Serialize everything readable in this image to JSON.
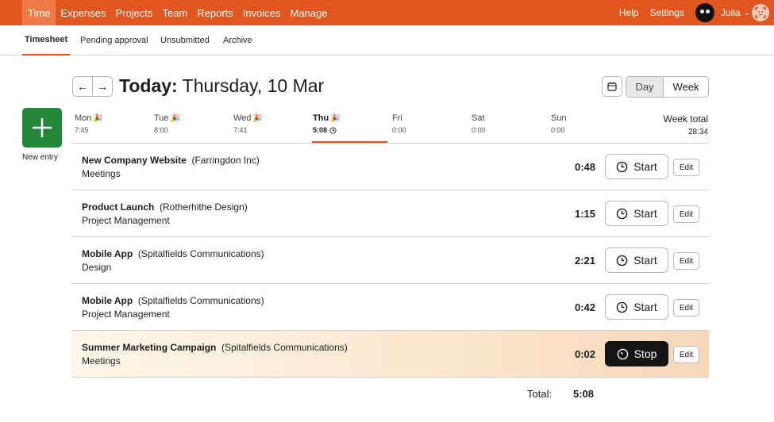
{
  "topnav": {
    "items": [
      "Time",
      "Expenses",
      "Projects",
      "Team",
      "Reports",
      "Invoices",
      "Manage"
    ],
    "help": "Help",
    "settings": "Settings",
    "user": "Julia",
    "brand_color": "#e1561f"
  },
  "subnav": {
    "tabs": [
      "Timesheet",
      "Pending approval",
      "Unsubmitted",
      "Archive"
    ],
    "active": "Timesheet"
  },
  "header": {
    "title_bold": "Today:",
    "title_rest": "Thursday, 10 Mar",
    "view_day": "Day",
    "view_week": "Week",
    "selected_view": "Day"
  },
  "new_entry": {
    "label": "New entry"
  },
  "days": [
    {
      "name": "Mon",
      "time": "7:45"
    },
    {
      "name": "Tue",
      "time": "8:00"
    },
    {
      "name": "Wed",
      "time": "7:41"
    },
    {
      "name": "Thu",
      "time": "5:08"
    },
    {
      "name": "Fri",
      "time": "0:00"
    },
    {
      "name": "Sat",
      "time": "0:00"
    },
    {
      "name": "Sun",
      "time": "0:00"
    }
  ],
  "week_total": {
    "label": "Week total",
    "value": "28:34"
  },
  "entries": [
    {
      "project": "New Company Website",
      "client": "(Farringdon Inc)",
      "task": "Meetings",
      "duration": "0:48",
      "action": "Start",
      "edit": "Edit"
    },
    {
      "project": "Product Launch",
      "client": "(Rotherhithe Design)",
      "task": "Project Management",
      "duration": "1:15",
      "action": "Start",
      "edit": "Edit"
    },
    {
      "project": "Mobile App",
      "client": "(Spitalfields Communications)",
      "task": "Design",
      "duration": "2:21",
      "action": "Start",
      "edit": "Edit"
    },
    {
      "project": "Mobile App",
      "client": "(Spitalfields Communications)",
      "task": "Project Management",
      "duration": "0:42",
      "action": "Start",
      "edit": "Edit"
    },
    {
      "project": "Summer Marketing Campaign",
      "client": "(Spitalfields Communications)",
      "task": "Meetings",
      "duration": "0:02",
      "action": "Stop",
      "edit": "Edit"
    }
  ],
  "total": {
    "label": "Total:",
    "value": "5:08"
  },
  "colors": {
    "accent": "#e1561f",
    "new_entry_green": "#24873a",
    "stop_button": "#141414"
  }
}
